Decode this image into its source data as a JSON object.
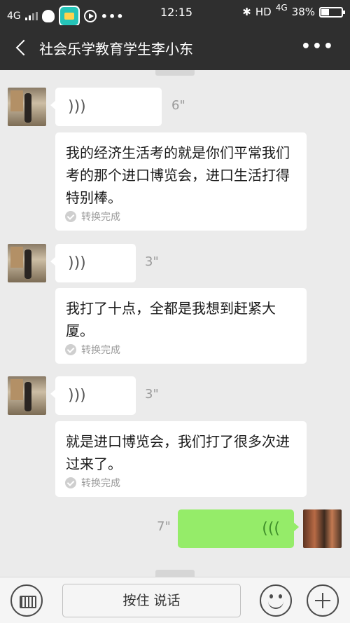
{
  "status_bar": {
    "network": "4G",
    "time": "12:15",
    "right_labels": [
      "HD",
      "4G"
    ],
    "battery": "38%"
  },
  "header": {
    "title": "社会乐学教育学生李小东",
    "back_icon": "chevron-left-icon",
    "more_icon": "more-dots-icon"
  },
  "messages": [
    {
      "sender": "other",
      "voice_duration": "6\"",
      "transcript": "我的经济生活考的就是你们平常我们考的那个进口博览会，进口生活打得特别棒。",
      "transcript_status": "转换完成"
    },
    {
      "sender": "other",
      "voice_duration": "3\"",
      "transcript": "我打了十点，全都是我想到赶紧大厦。",
      "transcript_status": "转换完成"
    },
    {
      "sender": "other",
      "voice_duration": "3\"",
      "transcript": "就是进口博览会，我们打了很多次进过来了。",
      "transcript_status": "转换完成"
    },
    {
      "sender": "self",
      "voice_duration": "7\""
    }
  ],
  "input_bar": {
    "hold_to_talk": "按住 说话",
    "keyboard_icon": "keyboard-icon",
    "emoji_icon": "emoji-icon",
    "plus_icon": "plus-icon"
  },
  "colors": {
    "header_bg": "#2f2f2f",
    "chat_bg": "#ebebeb",
    "self_bubble": "#95ec69",
    "other_bubble": "#ffffff"
  }
}
